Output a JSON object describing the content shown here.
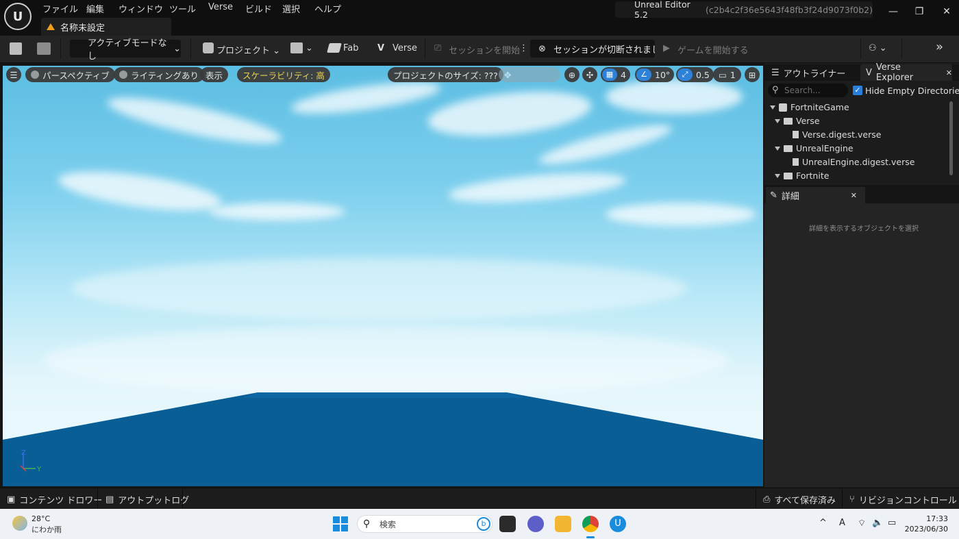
{
  "menu": {
    "items": [
      "ファイル",
      "編集",
      "ウィンドウ",
      "ツール",
      "Verse",
      "ビルド",
      "選択",
      "ヘルプ"
    ],
    "doc_tab": "名称未設定"
  },
  "window": {
    "title": "Unreal Editor 5.2",
    "hash": "(c2b4c2f36e5643f48fb3f24d9073f0b2)"
  },
  "toolbar": {
    "mode": "アクティブモードなし",
    "project": "プロジェクト",
    "fab": "Fab",
    "verse": "Verse",
    "start_session": "セッションを開始",
    "session_status": "セッションが切断されまし",
    "start_game": "ゲームを開始する"
  },
  "viewport": {
    "perspective": "パースペクティブ",
    "lighting": "ライティングあり",
    "show": "表示",
    "scalability": "スケーラビリティ: 高",
    "project_size": "プロジェクトのサイズ: ???",
    "grid_snap": "4",
    "rot_snap": "10°",
    "scale_snap": "0.5",
    "camera_speed": "1",
    "axis_z": "Z",
    "axis_y": "Y"
  },
  "panels": {
    "outliner_tab": "アウトライナー",
    "verse_tab": "Verse Explorer",
    "search_placeholder": "Search...",
    "hide_empty": "Hide Empty Directories",
    "tree": [
      {
        "label": "FortniteGame"
      },
      {
        "label": "Verse"
      },
      {
        "label": "Verse.digest.verse"
      },
      {
        "label": "UnrealEngine"
      },
      {
        "label": "UnrealEngine.digest.verse"
      },
      {
        "label": "Fortnite"
      }
    ],
    "details_tab": "詳細",
    "details_hint": "詳細を表示するオブジェクトを選択"
  },
  "statusbar": {
    "content_drawer": "コンテンツ ドロワー",
    "output_log": "アウトプットログ",
    "all_saved": "すべて保存済み",
    "revision_control": "リビジョンコントロール"
  },
  "taskbar": {
    "temperature": "28°C",
    "weather": "にわか雨",
    "search": "検索",
    "time": "17:33",
    "date": "2023/06/30"
  },
  "colors": {
    "accent": "#2a7fd8",
    "scalability_text": "#f5d442",
    "ground": "#0a5e96",
    "sky_top": "#5bbde3"
  }
}
